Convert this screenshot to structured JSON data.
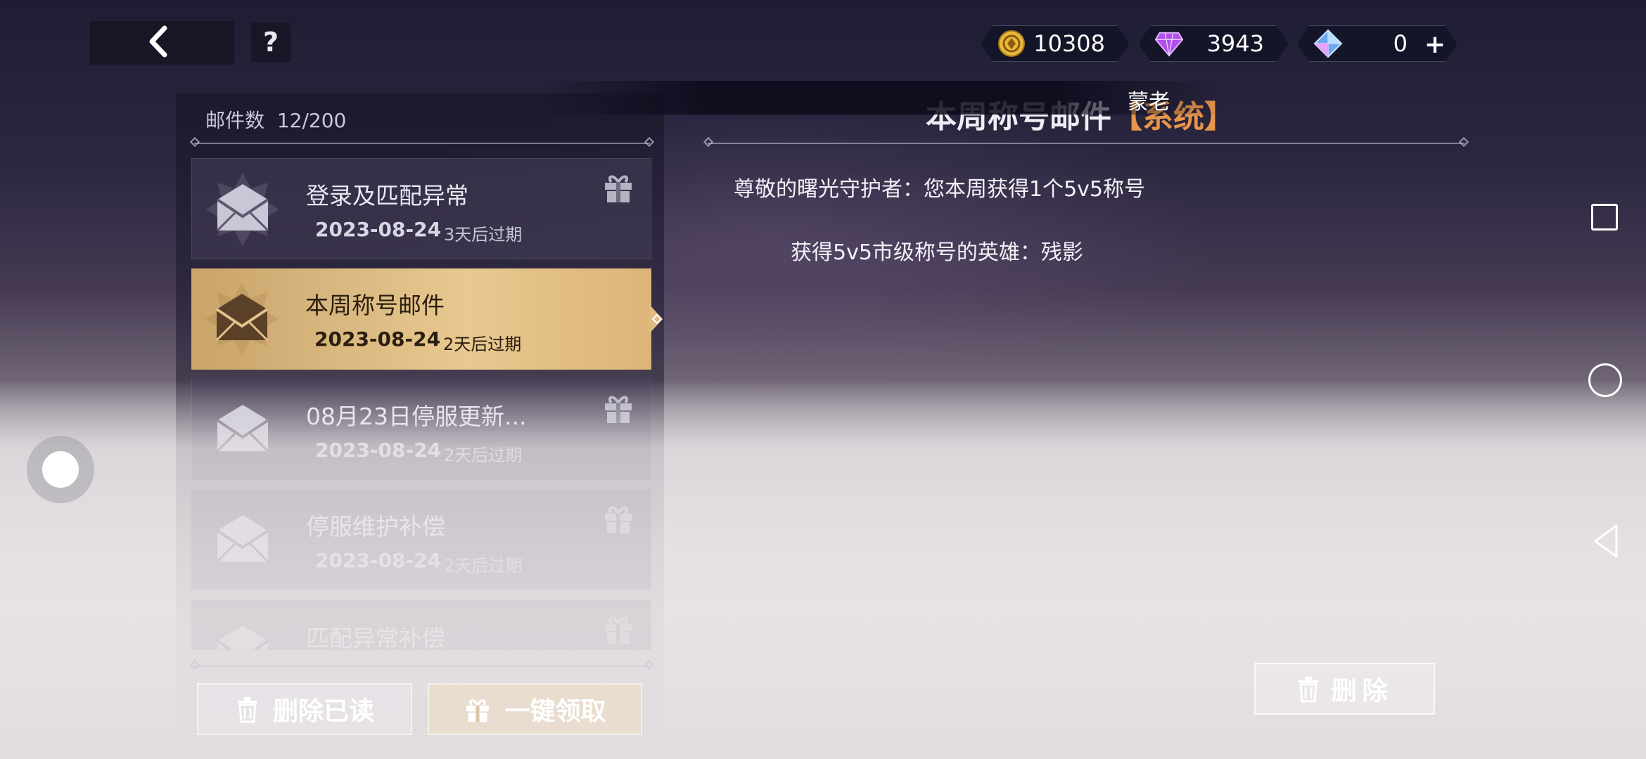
{
  "header": {
    "back_icon": "chevron-left-icon",
    "help_label": "?"
  },
  "currencies": [
    {
      "icon": "gold-coin-icon",
      "value": "10308"
    },
    {
      "icon": "purple-crystal-icon",
      "value": "3943"
    },
    {
      "icon": "blue-gem-icon",
      "value": "0"
    }
  ],
  "currency_add": "+",
  "mailbox": {
    "count_label": "邮件数",
    "count_value": "12/200",
    "items": [
      {
        "title": "登录及匹配异常",
        "date": "2023-08-24",
        "expire": "3天后过期",
        "has_gift": true,
        "selected": false
      },
      {
        "title": "本周称号邮件",
        "date": "2023-08-24",
        "expire": "2天后过期",
        "has_gift": false,
        "selected": true
      },
      {
        "title": "08月23日停服更新...",
        "date": "2023-08-24",
        "expire": "2天后过期",
        "has_gift": true,
        "selected": false
      },
      {
        "title": "停服维护补偿",
        "date": "2023-08-24",
        "expire": "2天后过期",
        "has_gift": true,
        "selected": false
      },
      {
        "title": "匹配异常补偿",
        "date": "",
        "expire": "",
        "has_gift": true,
        "selected": false
      }
    ],
    "delete_read_label": "删除已读",
    "claim_all_label": "一键领取"
  },
  "detail": {
    "title": "本周称号邮件",
    "tag": "【系统】",
    "sender": "蒙老",
    "line1": "尊敬的曙光守护者：您本周获得1个5v5称号",
    "line2": "获得5v5市级称号的英雄：残影",
    "delete_label": "删除"
  },
  "colors": {
    "selected_gold": "#e0bb80",
    "tag_orange": "#e8964a"
  }
}
